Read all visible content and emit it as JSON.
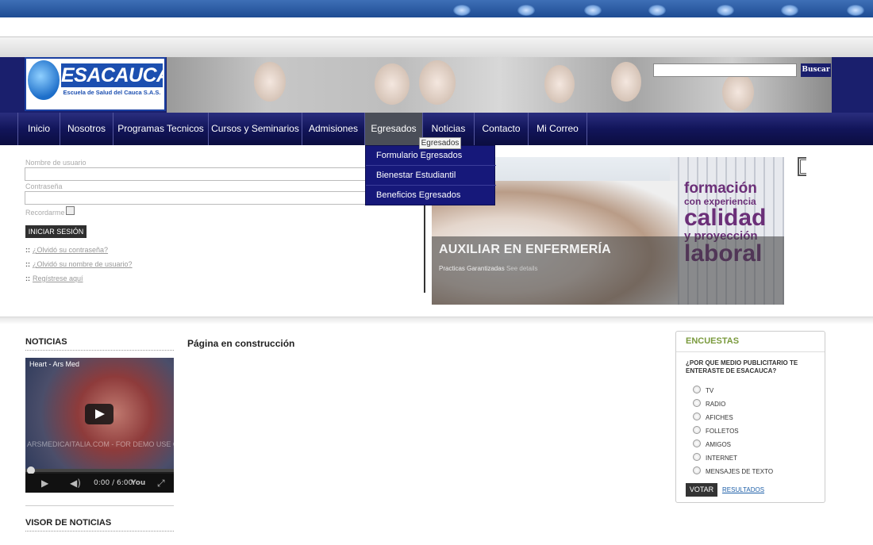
{
  "header": {
    "logo_name": "ESACAUCA",
    "logo_subtitle": "Escuela de Salud del Cauca S.A.S.",
    "search_button": "Buscar",
    "search_value": ""
  },
  "nav": {
    "items": [
      {
        "label": "Inicio"
      },
      {
        "label": "Nosotros"
      },
      {
        "label": "Programas Tecnicos"
      },
      {
        "label": "Cursos y Seminarios"
      },
      {
        "label": "Admisiones"
      },
      {
        "label": "Egresados"
      },
      {
        "label": "Noticias"
      },
      {
        "label": "Contacto"
      },
      {
        "label": "Mi Correo"
      }
    ],
    "tooltip": "Egresados",
    "dropdown": [
      {
        "label": "Formulario Egresados"
      },
      {
        "label": "Bienestar Estudiantil"
      },
      {
        "label": "Beneficios Egresados"
      }
    ]
  },
  "login": {
    "username_label": "Nombre de usuario",
    "password_label": "Contraseña",
    "remember_label": "Recordarme",
    "submit": "INICIAR SESIÓN",
    "bullet": "::",
    "links": [
      "¿Olvidó su contraseña?",
      "¿Olvidó su nombre de usuario?",
      "Regístrese aquí"
    ]
  },
  "slideshow": {
    "caption_title": "AUXILIAR EN ENFERMERÍA",
    "caption_text": "Practicas Garantizadas",
    "caption_link": "See details",
    "slogan": [
      "formación",
      "con experiencia",
      "calidad",
      "y proyección",
      "laboral"
    ]
  },
  "noticias": {
    "title": "NOTICIAS",
    "video_title": "Heart  -  Ars Med",
    "video_watermark": "ARSMEDICAITALIA.COM - FOR DEMO USE ONLY",
    "video_time": "0:00 / 6:00",
    "visor_title": "VISOR DE NOTICIAS"
  },
  "main": {
    "title": "Página en construcción"
  },
  "poll": {
    "title": "ENCUESTAS",
    "question": "¿POR QUE MEDIO PUBLICITARIO TE ENTERASTE DE ESACAUCA?",
    "options": [
      "TV",
      "RADIO",
      "AFICHES",
      "FOLLETOS",
      "AMIGOS",
      "INTERNET",
      "MENSAJES DE TEXTO"
    ],
    "vote": "VOTAR",
    "results": "RESULTADOS"
  },
  "colors": {
    "nav_bg": "#12155a",
    "dropdown_bg": "#16187a",
    "poll_title": "#7a9a3d",
    "slogan": "#6b2f78"
  }
}
